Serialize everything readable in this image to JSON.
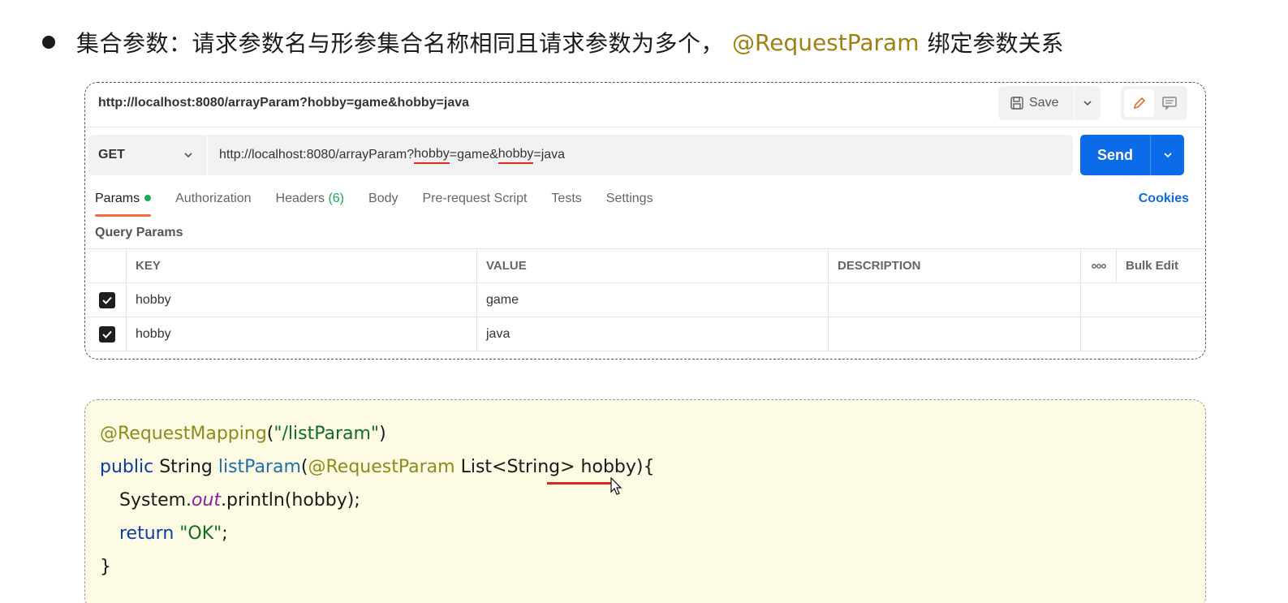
{
  "headline": {
    "text": "集合参数：请求参数名与形参集合名称相同且请求参数为多个，",
    "annotation": "@RequestParam",
    "tail": "绑定参数关系"
  },
  "postman": {
    "tab_url": "http://localhost:8080/arrayParam?hobby=game&hobby=java",
    "save_label": "Save",
    "method": "GET",
    "url": {
      "part1": "http://localhost:8080/arrayParam?",
      "key1": "hobby",
      "part2": "=game&",
      "key2": "hobby",
      "part3": "=java"
    },
    "send_label": "Send",
    "tabs": {
      "params": "Params",
      "authorization": "Authorization",
      "headers": "Headers",
      "headers_count": "(6)",
      "body": "Body",
      "prerequest": "Pre-request Script",
      "tests": "Tests",
      "settings": "Settings"
    },
    "cookies": "Cookies",
    "query_params_label": "Query Params",
    "columns": {
      "key": "KEY",
      "value": "VALUE",
      "description": "DESCRIPTION",
      "more": "ooo",
      "bulk_edit": "Bulk Edit"
    },
    "rows": [
      {
        "key": "hobby",
        "value": "game",
        "description": ""
      },
      {
        "key": "hobby",
        "value": "java",
        "description": ""
      }
    ]
  },
  "code": {
    "line1": {
      "annotation": "@RequestMapping",
      "open": "(",
      "path": "\"/listParam\"",
      "close": ")"
    },
    "line2": {
      "kw": "public",
      "type": " String ",
      "fn": "listParam",
      "open": "(",
      "annotation": "@RequestParam",
      "rest": " List<String> hobby){"
    },
    "line3": {
      "obj": "System.",
      "field": "out",
      "call": ".println(hobby);"
    },
    "line4": {
      "kw": "return",
      "str": " \"OK\"",
      "end": ";"
    },
    "line5": "}"
  }
}
